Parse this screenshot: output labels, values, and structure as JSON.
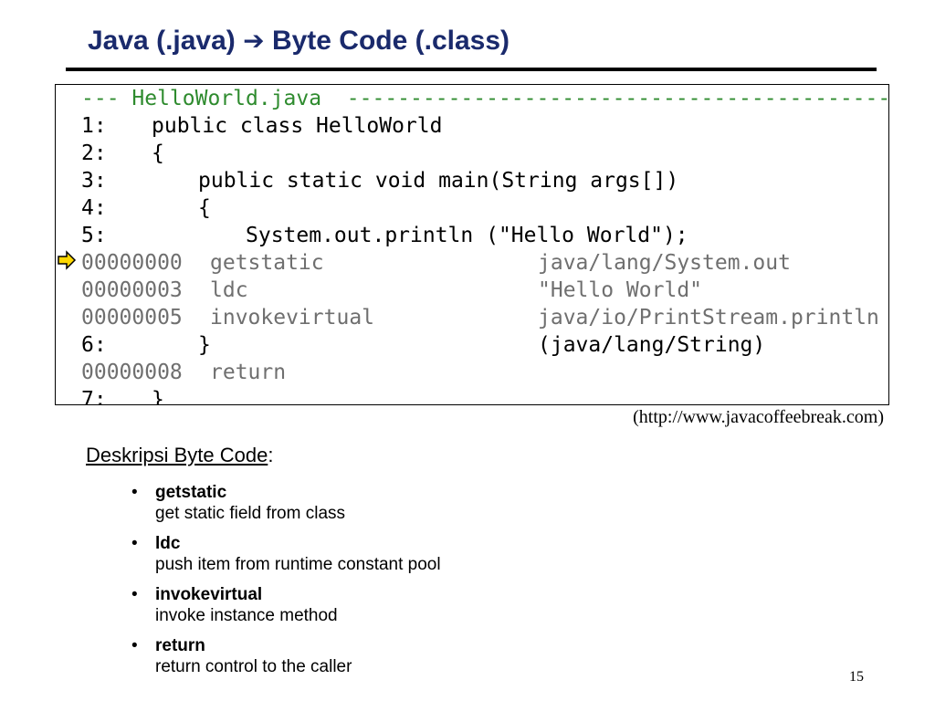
{
  "slide": {
    "title_left": "Java (.java)",
    "title_arrow": "➔",
    "title_right": "Byte Code (.class)",
    "page_number": "15"
  },
  "code": {
    "header": "--- HelloWorld.java  -----------------------------------------------",
    "lines": [
      {
        "kind": "src",
        "num": "1:",
        "text": "public class HelloWorld"
      },
      {
        "kind": "src",
        "num": "2:",
        "text": "{"
      },
      {
        "kind": "src",
        "num": "3:",
        "text": "public static void main(String args[])"
      },
      {
        "kind": "src",
        "num": "4:",
        "text": "{"
      },
      {
        "kind": "src",
        "num": "5:",
        "text": "System.out.println (\"Hello World\");"
      },
      {
        "kind": "bc",
        "num": "00000000",
        "text": "getstatic",
        "arg": "java/lang/System.out"
      },
      {
        "kind": "bc",
        "num": "00000003",
        "text": "ldc",
        "arg": "\"Hello World\""
      },
      {
        "kind": "bc",
        "num": "00000005",
        "text": "invokevirtual",
        "arg": "java/io/PrintStream.println"
      },
      {
        "kind": "src",
        "num": "6:",
        "text": "}",
        "arg": "(java/lang/String)"
      },
      {
        "kind": "bc",
        "num": "00000008",
        "text": "return"
      },
      {
        "kind": "src",
        "num": "7:",
        "text": "}"
      }
    ]
  },
  "source_ref": "(http://www.javacoffeebreak.com)",
  "section": {
    "heading": "Deskripsi Byte Code",
    "heading_suffix": ":",
    "bullets": [
      {
        "term": "getstatic",
        "desc": "get static field from class"
      },
      {
        "term": "ldc",
        "desc": "push item from runtime constant pool"
      },
      {
        "term": "invokevirtual",
        "desc": "invoke instance method"
      },
      {
        "term": "return",
        "desc": "return control to the caller"
      }
    ]
  },
  "colors": {
    "title": "#1a2a6c",
    "header_green": "#2e8b2e",
    "bytecode_gray": "#6f6f6f",
    "pointer_yellow": "#ffd800"
  }
}
